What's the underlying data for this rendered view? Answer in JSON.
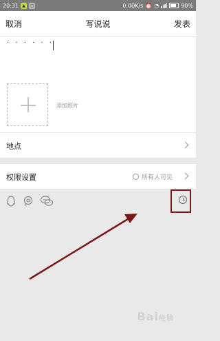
{
  "status_bar": {
    "time": "20:31",
    "speed": "0.00K/s",
    "battery": "90%"
  },
  "header": {
    "cancel": "取消",
    "title": "写说说",
    "publish": "发表"
  },
  "compose": {
    "text": "·  ·  ·  ·  ·  ·",
    "add_photo_label": "添加照片"
  },
  "location": {
    "label": "地点"
  },
  "permission": {
    "label": "权限设置",
    "value": "所有人可见"
  },
  "toolbar": {
    "icons": [
      "qq-penguin-icon",
      "mention-icon",
      "chat-bubbles-icon",
      "clock-icon"
    ]
  },
  "annotation": {
    "color": "#7a1616"
  },
  "watermark": {
    "text": "Bai",
    "suffix": "经验"
  }
}
